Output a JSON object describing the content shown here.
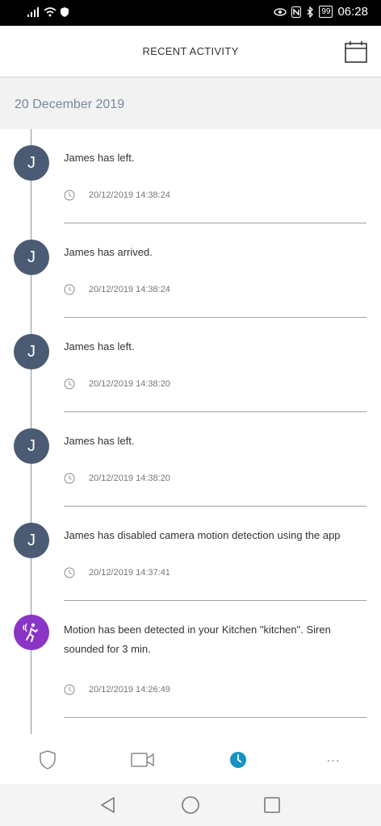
{
  "status_bar": {
    "battery": "99",
    "time": "06:28"
  },
  "header": {
    "title": "RECENT ACTIVITY"
  },
  "date_group": "20 December 2019",
  "activities": [
    {
      "avatar": "J",
      "text": "James has left.",
      "time": "20/12/2019 14:38:24"
    },
    {
      "avatar": "J",
      "text": "James has arrived.",
      "time": "20/12/2019 14:38:24"
    },
    {
      "avatar": "J",
      "text": "James has left.",
      "time": "20/12/2019 14:38:20"
    },
    {
      "avatar": "J",
      "text": "James has left.",
      "time": "20/12/2019 14:38:20"
    },
    {
      "avatar": "J",
      "text": "James has disabled camera motion detection using the app",
      "time": "20/12/2019 14:37:41"
    },
    {
      "avatar": "motion-icon",
      "text": "Motion has been detected in your Kitchen \"kitchen\". Siren sounded for 3 min.",
      "time": "20/12/2019 14:26:49"
    }
  ],
  "bottom_nav": {
    "items": [
      "shield-icon",
      "camera-icon",
      "clock-icon",
      "more-icon"
    ],
    "active": "clock-icon",
    "more_label": "···"
  },
  "colors": {
    "avatar": "#4b5b73",
    "motion": "#8b35c6",
    "accent": "#1593c2"
  }
}
